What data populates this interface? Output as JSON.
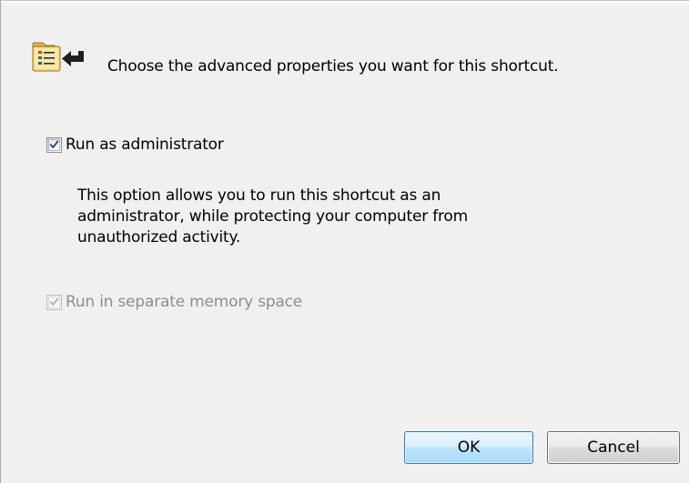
{
  "header": {
    "icon": "shortcut-properties-icon",
    "text": "Choose the advanced properties you want for this shortcut."
  },
  "options": {
    "run_as_admin": {
      "label": "Run as administrator",
      "checked": true,
      "enabled": true,
      "description": "This option allows you to run this shortcut as an\nadministrator, while protecting your computer from\nunauthorized activity."
    },
    "separate_memory": {
      "label": "Run in separate memory space",
      "checked": true,
      "enabled": false
    }
  },
  "buttons": {
    "ok_label": "OK",
    "cancel_label": "Cancel"
  },
  "colors": {
    "dialog_background": "#f0f0f0",
    "checkmark": "#2a4a8a",
    "disabled_text": "#8d8d8d",
    "ok_border": "#3c7fb1"
  }
}
